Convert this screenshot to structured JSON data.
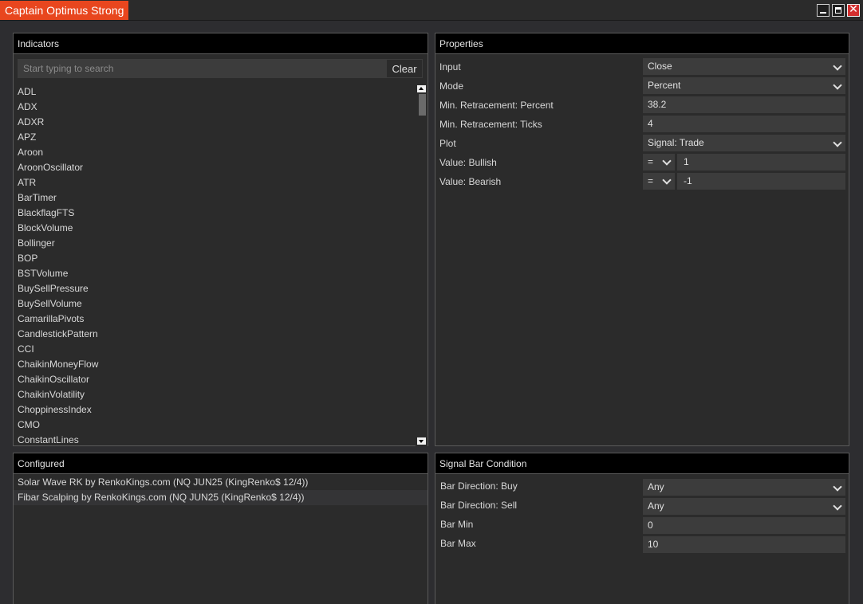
{
  "window": {
    "title": "Captain Optimus Strong",
    "minimize_icon": "minimize-icon",
    "maximize_icon": "maximize-icon",
    "close_icon": "close-icon",
    "close_glyph": "✕"
  },
  "indicators": {
    "header": "Indicators",
    "search_placeholder": "Start typing to search",
    "search_value": "",
    "clear_label": "Clear",
    "items": [
      "ADL",
      "ADX",
      "ADXR",
      "APZ",
      "Aroon",
      "AroonOscillator",
      "ATR",
      "BarTimer",
      "BlackflagFTS",
      "BlockVolume",
      "Bollinger",
      "BOP",
      "BSTVolume",
      "BuySellPressure",
      "BuySellVolume",
      "CamarillaPivots",
      "CandlestickPattern",
      "CCI",
      "ChaikinMoneyFlow",
      "ChaikinOscillator",
      "ChaikinVolatility",
      "ChoppinessIndex",
      "CMO",
      "ConstantLines"
    ]
  },
  "properties": {
    "header": "Properties",
    "rows": [
      {
        "label": "Input",
        "value": "Close"
      },
      {
        "label": "Mode",
        "value": "Percent"
      },
      {
        "label": "Min. Retracement: Percent",
        "value": "38.2"
      },
      {
        "label": "Min. Retracement: Ticks",
        "value": "4"
      },
      {
        "label": "Plot",
        "value": "Signal: Trade"
      },
      {
        "label": "Value: Bullish",
        "operator": "=",
        "value": "1"
      },
      {
        "label": "Value: Bearish",
        "operator": "=",
        "value": "-1"
      }
    ]
  },
  "configured": {
    "header": "Configured",
    "items": [
      "Solar Wave RK by RenkoKings.com (NQ JUN25 (KingRenko$ 12/4))",
      "Fibar Scalping by RenkoKings.com (NQ JUN25 (KingRenko$ 12/4))"
    ]
  },
  "signal_bar_condition": {
    "header": "Signal Bar Condition",
    "rows": [
      {
        "label": "Bar Direction: Buy",
        "value": "Any"
      },
      {
        "label": "Bar Direction: Sell",
        "value": "Any"
      },
      {
        "label": "Bar Min",
        "value": "0"
      },
      {
        "label": "Bar Max",
        "value": "10"
      }
    ]
  },
  "colors": {
    "accent": "#e8461e",
    "background": "#2d2d30",
    "panel_header": "#000000",
    "field": "#3c3c3c"
  }
}
